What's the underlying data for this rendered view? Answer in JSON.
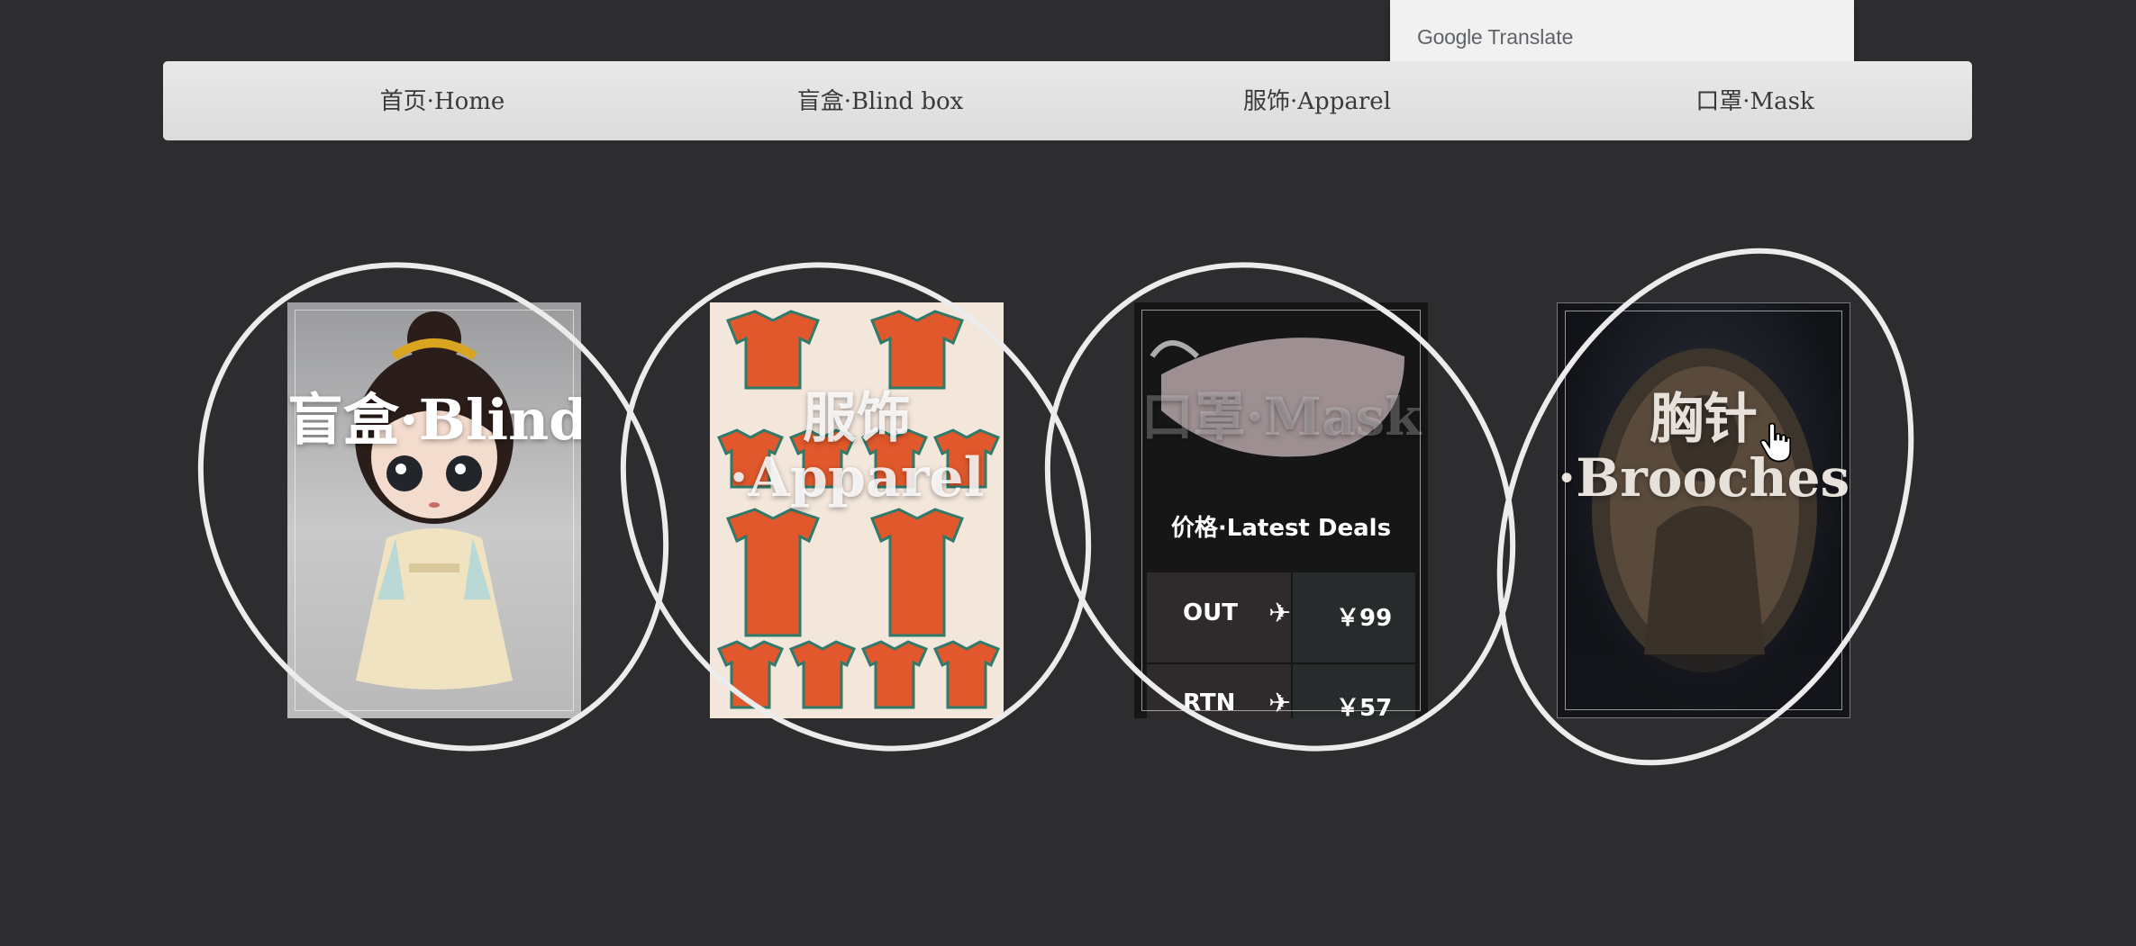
{
  "translate_banner": {
    "brand": "Google",
    "product": "Translate"
  },
  "nav": {
    "items": [
      {
        "label": "首页·Home"
      },
      {
        "label": "盲盒·Blind box"
      },
      {
        "label": "服饰·Apparel"
      },
      {
        "label": "口罩·Mask"
      }
    ]
  },
  "cards": [
    {
      "title": "盲盒·Blind"
    },
    {
      "title_line1": "服饰",
      "title_line2": "·Apparel"
    },
    {
      "title": "口罩·Mask",
      "deals_heading": "价格·Latest Deals",
      "deals": [
        {
          "route": "OUT",
          "price": "￥99"
        },
        {
          "route": "RTN",
          "price": "￥57"
        }
      ]
    },
    {
      "title_line1": "胸针",
      "title_line2": "·Brooches"
    }
  ],
  "icons": {
    "airplane": "airplane-icon",
    "cursor": "hand-pointer-icon"
  }
}
